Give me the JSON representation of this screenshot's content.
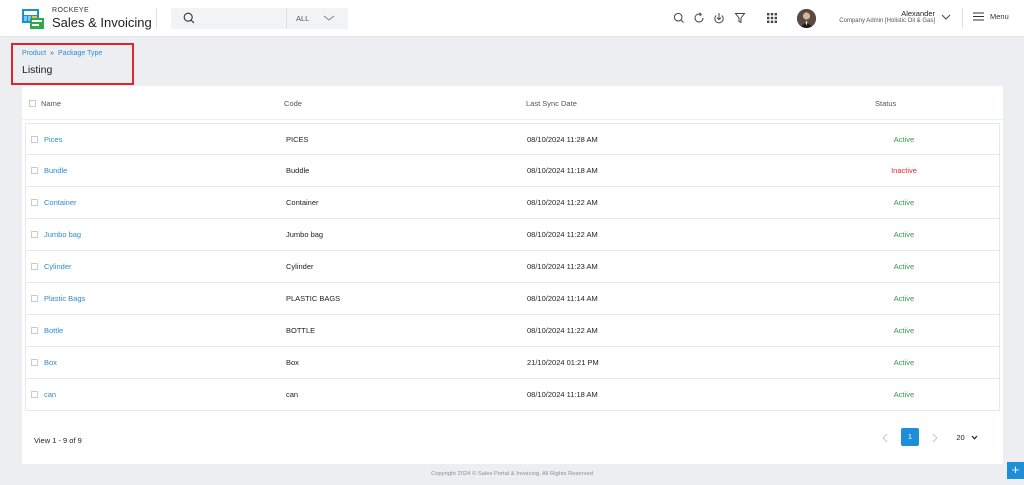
{
  "app": {
    "brand_top": "ROCKEYE",
    "brand_main": "Sales & Invoicing"
  },
  "search": {
    "placeholder": "",
    "scope": "ALL"
  },
  "header_icons": [
    "search-icon",
    "refresh-icon",
    "download-icon",
    "filter-icon",
    "apps-grid-icon"
  ],
  "user": {
    "name": "Alexander",
    "role": "Company Admin [Holistic Oil & Gas]"
  },
  "menu": {
    "label": "Menu"
  },
  "breadcrumb": {
    "parent": "Product",
    "separator": "»",
    "current": "Package Type"
  },
  "page": {
    "title": "Listing"
  },
  "table": {
    "columns": {
      "name": "Name",
      "code": "Code",
      "last_sync": "Last Sync Date",
      "status": "Status"
    },
    "rows": [
      {
        "name": "Pices",
        "code": "PICES",
        "last_sync": "08/10/2024 11:28 AM",
        "status": "Active"
      },
      {
        "name": "Bundle",
        "code": "Buddle",
        "last_sync": "08/10/2024 11:18 AM",
        "status": "Inactive"
      },
      {
        "name": "Container",
        "code": "Container",
        "last_sync": "08/10/2024 11:22 AM",
        "status": "Active"
      },
      {
        "name": "Jumbo bag",
        "code": "Jumbo bag",
        "last_sync": "08/10/2024 11:22 AM",
        "status": "Active"
      },
      {
        "name": "Cylinder",
        "code": "Cylinder",
        "last_sync": "08/10/2024 11:23 AM",
        "status": "Active"
      },
      {
        "name": "Plastic Bags",
        "code": "PLASTIC BAGS",
        "last_sync": "08/10/2024 11:14 AM",
        "status": "Active"
      },
      {
        "name": "Bottle",
        "code": "BOTTLE",
        "last_sync": "08/10/2024 11:22 AM",
        "status": "Active"
      },
      {
        "name": "Box",
        "code": "Box",
        "last_sync": "21/10/2024 01:21 PM",
        "status": "Active"
      },
      {
        "name": "can",
        "code": "can",
        "last_sync": "08/10/2024 11:18 AM",
        "status": "Active"
      }
    ]
  },
  "pagination": {
    "summary": "View 1 - 9 of 9",
    "current_page": "1",
    "per_page": "20"
  },
  "footer": {
    "copyright": "Copyright 2024 © Sales Portal & Invoicing. All Rights Reserved"
  },
  "fab": {
    "label": "+"
  },
  "colors": {
    "accent": "#1d8fd8",
    "link": "#2d8ad6",
    "active": "#2f9e44",
    "inactive": "#e0262c",
    "highlight_box": "#e0262c"
  }
}
